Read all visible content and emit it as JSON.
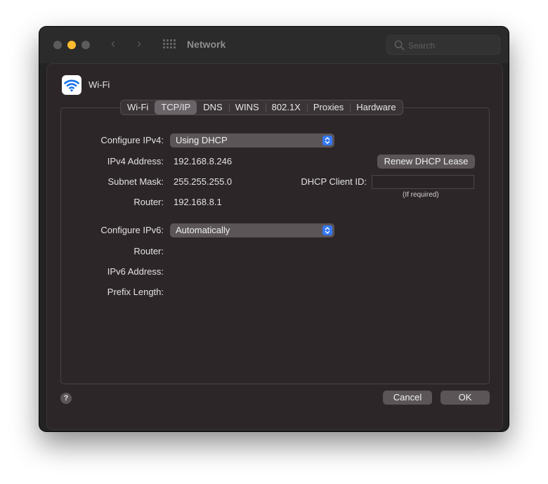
{
  "window": {
    "title": "Network",
    "search_placeholder": "Search"
  },
  "sheet": {
    "interface_name": "Wi-Fi",
    "tabs": [
      "Wi-Fi",
      "TCP/IP",
      "DNS",
      "WINS",
      "802.1X",
      "Proxies",
      "Hardware"
    ],
    "active_tab": "TCP/IP"
  },
  "ipv4": {
    "configure_label": "Configure IPv4:",
    "configure_value": "Using DHCP",
    "address_label": "IPv4 Address:",
    "address_value": "192.168.8.246",
    "subnet_label": "Subnet Mask:",
    "subnet_value": "255.255.255.0",
    "router_label": "Router:",
    "router_value": "192.168.8.1"
  },
  "dhcp": {
    "renew_label": "Renew DHCP Lease",
    "client_id_label": "DHCP Client ID:",
    "client_id_value": "",
    "client_id_hint": "(If required)"
  },
  "ipv6": {
    "configure_label": "Configure IPv6:",
    "configure_value": "Automatically",
    "router_label": "Router:",
    "address_label": "IPv6 Address:",
    "prefix_label": "Prefix Length:"
  },
  "footer": {
    "help_label": "?",
    "cancel_label": "Cancel",
    "ok_label": "OK"
  },
  "colors": {
    "accent": "#3478f6",
    "minimize_light": "#febc2e",
    "wifi_icon": "#1a73e8"
  }
}
